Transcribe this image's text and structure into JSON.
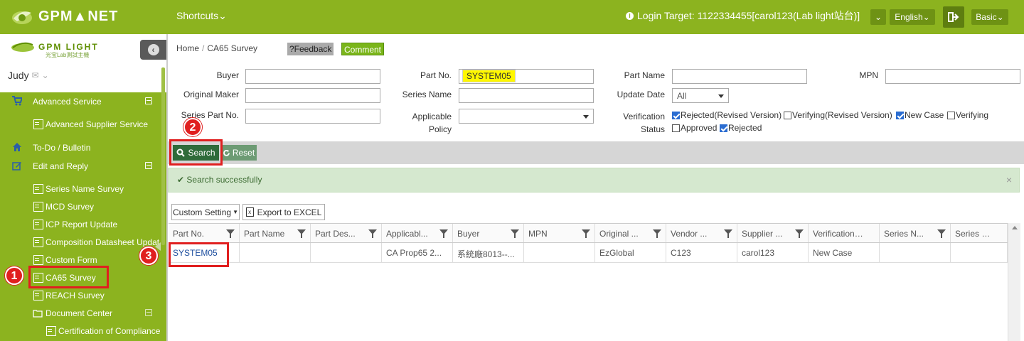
{
  "topbar": {
    "logo": "GPM▲NET",
    "shortcuts": "Shortcuts",
    "login_target": "Login Target: 1122334455[carol123(Lab light站台)]",
    "language": "English",
    "basic": "Basic",
    "chevron": "⌄",
    "bg_color": "#8cb31f"
  },
  "sidebar": {
    "logo": "GPM LIGHT",
    "logo_sub": "光宝Lab測試主機",
    "user": "Judy",
    "items": [
      {
        "label": "Advanced Service",
        "icon": "cart-icon"
      },
      {
        "label": "Advanced Supplier Service",
        "icon": "document-icon"
      },
      {
        "label": "To-Do / Bulletin",
        "icon": "home-icon"
      },
      {
        "label": "Edit and Reply",
        "icon": "edit-icon"
      },
      {
        "label": "Series Name Survey",
        "icon": "document-icon"
      },
      {
        "label": "MCD Survey",
        "icon": "document-icon"
      },
      {
        "label": "ICP Report Update",
        "icon": "document-icon"
      },
      {
        "label": "Composition Datasheet Updat",
        "icon": "document-icon"
      },
      {
        "label": "Custom Form",
        "icon": "document-icon"
      },
      {
        "label": "CA65 Survey",
        "icon": "document-icon"
      },
      {
        "label": "REACH Survey",
        "icon": "document-icon"
      },
      {
        "label": "Document Center",
        "icon": "folder-icon"
      },
      {
        "label": "Certification of Compliance",
        "icon": "document-icon"
      }
    ]
  },
  "breadcrumb": {
    "home": "Home",
    "sep": "/",
    "current": "CA65 Survey"
  },
  "buttons": {
    "feedback": "?Feedback",
    "comment": "Comment",
    "search": "Search",
    "reset": "Reset",
    "custom_setting": "Custom Setting",
    "export": "Export to EXCEL"
  },
  "form": {
    "buyer": "Buyer",
    "original_maker": "Original Maker",
    "series_part_no": "Series Part No.",
    "part_no": "Part No.",
    "part_no_value": "SYSTEM05",
    "series_name": "Series Name",
    "applicable_policy_1": "Applicable",
    "applicable_policy_2": "Policy",
    "part_name": "Part Name",
    "update_date": "Update Date",
    "update_date_value": "All",
    "verification_status_1": "Verification",
    "verification_status_2": "Status",
    "mpn": "MPN",
    "checks": [
      {
        "label": "Rejected(Revised Version)",
        "checked": true
      },
      {
        "label": "Verifying(Revised Version)",
        "checked": false
      },
      {
        "label": "New Case",
        "checked": true
      },
      {
        "label": "Verifying",
        "checked": false
      },
      {
        "label": "Approved",
        "checked": false
      },
      {
        "label": "Rejected",
        "checked": true
      }
    ]
  },
  "message": {
    "text": "Search successfully",
    "close": "×"
  },
  "table": {
    "headers": [
      "Part No.",
      "Part Name",
      "Part Des...",
      "Applicabl...",
      "Buyer",
      "MPN",
      "Original ...",
      "Vendor ...",
      "Supplier ...",
      "Verification St...",
      "Series N...",
      "Series P..."
    ],
    "rows": [
      [
        "SYSTEM05",
        "",
        "",
        "CA Prop65 2...",
        "系統廠8013--...",
        "",
        "EzGlobal",
        "C123",
        "carol123",
        "New Case",
        "",
        ""
      ]
    ]
  },
  "annotations": [
    "1",
    "2",
    "3"
  ],
  "colors": {
    "annotation_red": "#e01f1f",
    "sidebar_green": "#8cb31f",
    "search_btn": "#2f6b3a",
    "highlight": "#fff700"
  }
}
